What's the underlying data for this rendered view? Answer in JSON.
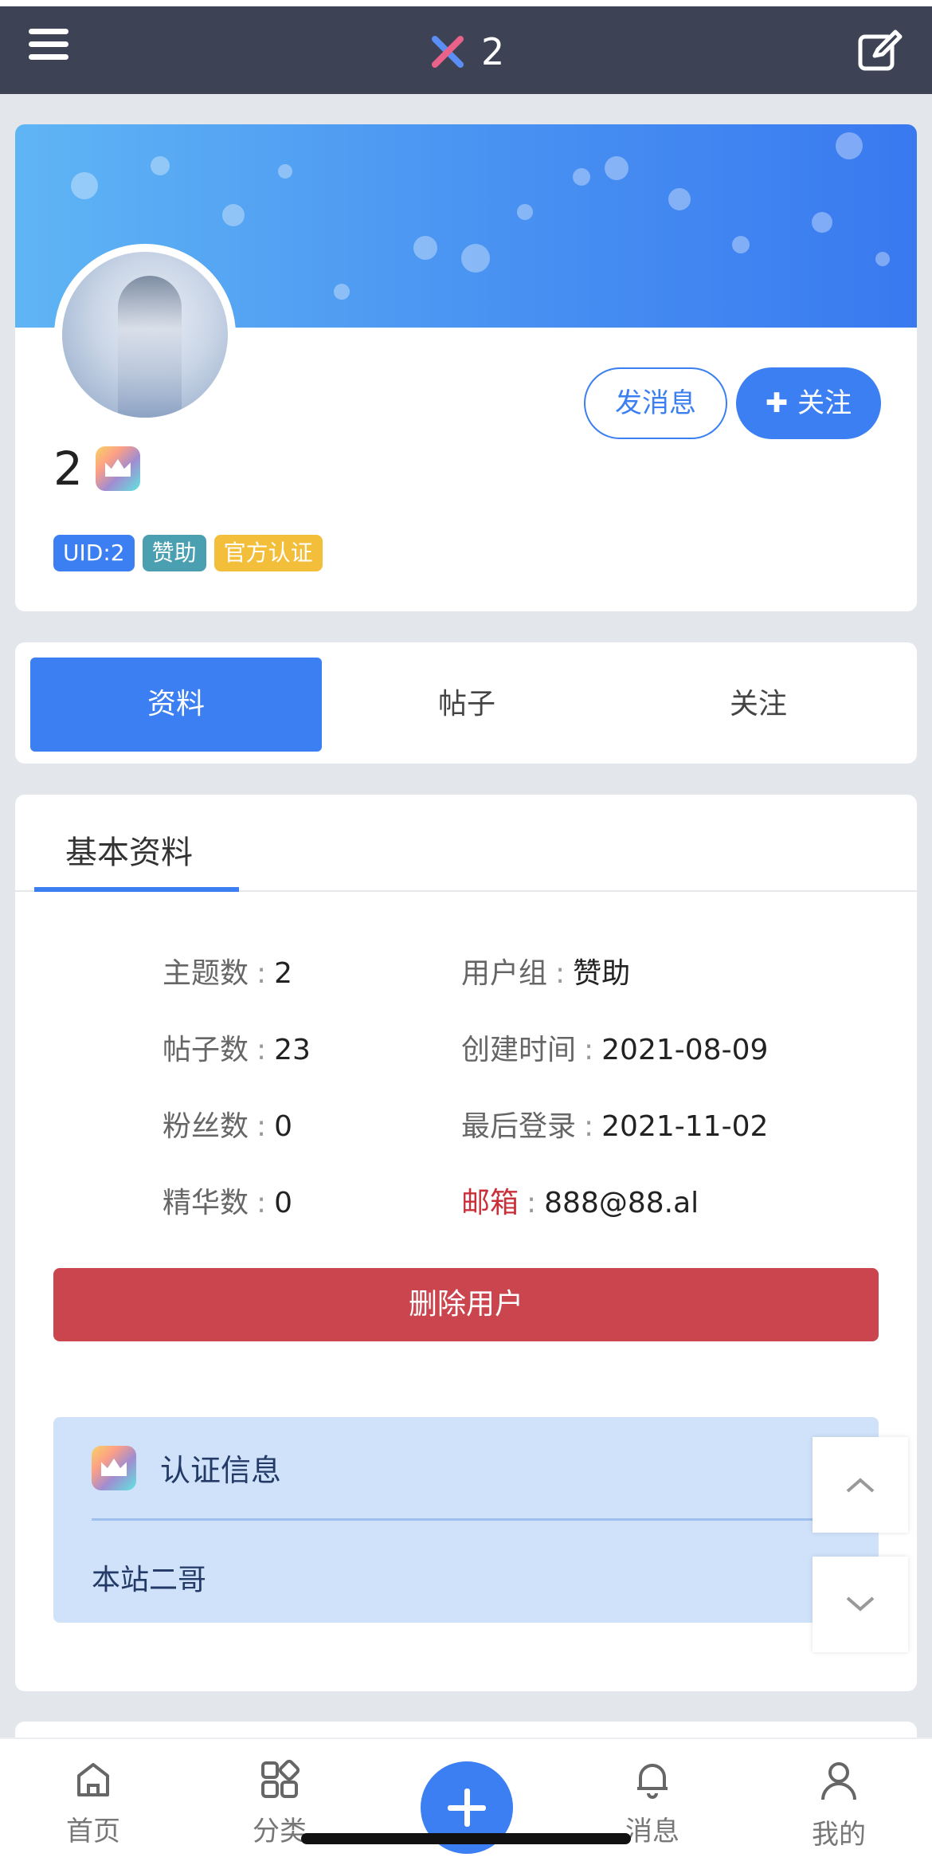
{
  "header": {
    "title": "2",
    "menu_icon": "menu-icon",
    "logo_icon": "x-logo-icon",
    "edit_icon": "edit-icon"
  },
  "profile": {
    "username": "2",
    "badges": {
      "uid": "UID:2",
      "group": "赞助",
      "verified": "官方认证"
    },
    "send_message": "发消息",
    "follow": "关注"
  },
  "tabs": {
    "profile": "资料",
    "posts": "帖子",
    "following": "关注"
  },
  "info": {
    "section_title": "基本资料",
    "topics_label": "主题数",
    "topics_value": "2",
    "posts_label": "帖子数",
    "posts_value": "23",
    "fans_label": "粉丝数",
    "fans_value": "0",
    "featured_label": "精华数",
    "featured_value": "0",
    "group_label": "用户组",
    "group_value": "赞助",
    "created_label": "创建时间",
    "created_value": "2021-08-09",
    "lastlogin_label": "最后登录",
    "lastlogin_value": "2021-11-02",
    "email_label": "邮箱",
    "email_value": "888@88.al",
    "colon": ":",
    "delete_button": "删除用户",
    "cert_title": "认证信息",
    "cert_value": "本站二哥"
  },
  "bottom_nav": {
    "home": "首页",
    "category": "分类",
    "messages": "消息",
    "mine": "我的"
  },
  "colors": {
    "accent": "#3b7ff2",
    "danger": "#ca454d",
    "header_bg": "#3d4354"
  }
}
